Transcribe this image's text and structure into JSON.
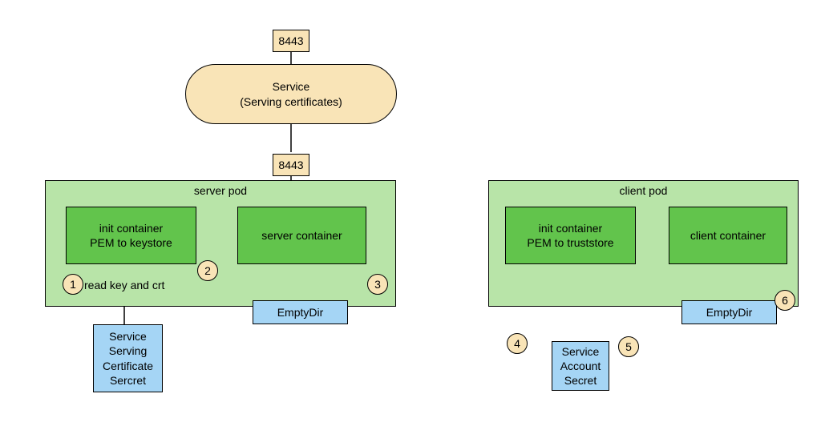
{
  "service": {
    "port": "8443",
    "title1": "Service",
    "title2": "(Serving certificates)"
  },
  "serverPod": {
    "port": "8443",
    "label": "server pod",
    "init": {
      "line1": "init container",
      "line2": "PEM to keystore"
    },
    "container": "server container",
    "emptydir": "EmptyDir",
    "secret1": "Service",
    "secret2": "Serving",
    "secret3": "Certificate",
    "secret4": "Sercret",
    "readLabel": "read key and crt"
  },
  "clientPod": {
    "label": "client pod",
    "init": {
      "line1": "init container",
      "line2": "PEM to truststore"
    },
    "container": "client container",
    "emptydir": "EmptyDir",
    "secret1": "Service",
    "secret2": "Account",
    "secret3": "Secret"
  },
  "callouts": {
    "c1": "1",
    "c2": "2",
    "c3": "3",
    "c4": "4",
    "c5": "5",
    "c6": "6"
  },
  "colors": {
    "yellow": "#f9e4b7",
    "podgreen": "#b8e4a8",
    "boxgreen": "#62c44c",
    "blue": "#a5d5f5"
  }
}
